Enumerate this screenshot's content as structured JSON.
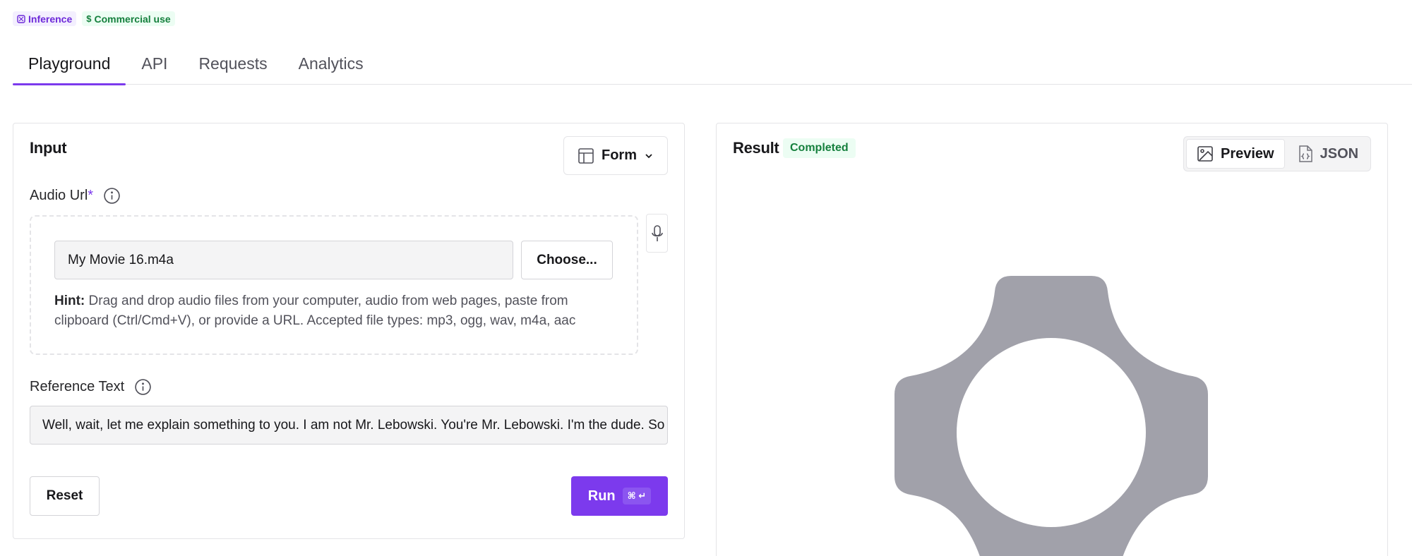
{
  "badges": [
    {
      "label": "Inference",
      "icon": "sparkle-icon"
    },
    {
      "label": "Commercial use",
      "icon": "dollar-icon"
    }
  ],
  "tabs": [
    {
      "label": "Playground",
      "active": true
    },
    {
      "label": "API",
      "active": false
    },
    {
      "label": "Requests",
      "active": false
    },
    {
      "label": "Analytics",
      "active": false
    }
  ],
  "input_panel": {
    "title": "Input",
    "form_toggle_label": "Form",
    "audio_url": {
      "label": "Audio Url",
      "required_marker": "*",
      "file_value": "My Movie 16.m4a",
      "choose_label": "Choose...",
      "hint_bold": "Hint:",
      "hint_text": " Drag and drop audio files from your computer, audio from web pages, paste from clipboard (Ctrl/Cmd+V), or provide a URL. Accepted file types: mp3, ogg, wav, m4a, aac"
    },
    "reference_text": {
      "label": "Reference Text",
      "value": "Well, wait, let me explain something to you.  I am not Mr. Lebowski.  You're Mr. Lebowski.  I'm the dude. So that's what you call me."
    },
    "reset_label": "Reset",
    "run_label": "Run",
    "run_shortcut": "⌘ ↵"
  },
  "result_panel": {
    "title": "Result",
    "status": "Completed",
    "views": [
      {
        "label": "Preview",
        "icon": "image-icon",
        "active": true
      },
      {
        "label": "JSON",
        "icon": "file-json-icon",
        "active": false
      }
    ]
  },
  "colors": {
    "accent": "#7c3aed",
    "success": "#15803d",
    "placeholder_gray": "#a1a1aa"
  }
}
